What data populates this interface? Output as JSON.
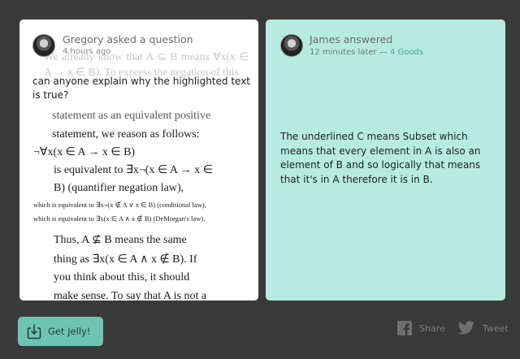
{
  "question": {
    "author_line": "Gregory asked a question",
    "time": "4 hours ago",
    "text": "can anyone explain why the highlighted text is true?",
    "document": {
      "faded_paragraph": "We already know that A ⊆ B means ∀x(x ∈ A → x ∈ B). To express the negation of this",
      "line_a": "statement as an equivalent positive",
      "line_b": "statement, we reason as follows:",
      "line_c": "¬∀x(x ∈ A → x ∈ B)",
      "line_d": "is equivalent to ∃x¬(x ∈ A → x ∈",
      "line_e": "B)  (quantifier negation law),",
      "line_f": "which is equivalent to  ∃x¬(x ∉ A ∨ x ∈ B)   (conditional law),",
      "line_g": "which is equivalent to  ∃x(x ∈ A ∧ x ∉ B)     (DeMorgan's law).",
      "line_h": "Thus,  A  ⊈  B  means  the  same",
      "line_i": "thing  as  ∃x(x  ∈  A  ∧  x  ∉  B).  If",
      "line_j": "you  think  about  this,  it  should",
      "line_k": "make  sense.  To  say  that  A  is  not  a"
    }
  },
  "answer": {
    "author_line": "James answered",
    "time": "12 minutes later",
    "separator": "—",
    "goods": "4 Goods",
    "text": "The underlined C means Subset which means that every element in A is also an element of B and so logically that means that it's in A therefore it is in B."
  },
  "footer": {
    "get_jelly_label": "Get Jelly!",
    "share_label": "Share",
    "tweet_label": "Tweet"
  },
  "colors": {
    "background": "#3a3a3a",
    "question_card": "#ffffff",
    "answer_card": "#b7ebe0",
    "accent": "#6ec4b2",
    "goods": "#49a98f"
  },
  "icons": [
    "download-icon",
    "facebook-icon",
    "twitter-icon",
    "avatar"
  ]
}
